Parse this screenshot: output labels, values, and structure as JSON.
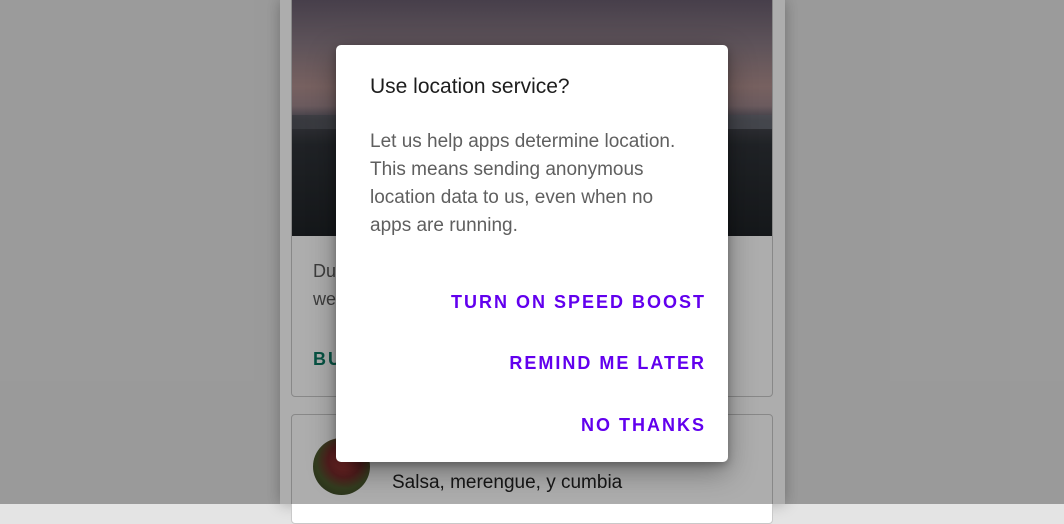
{
  "background_card": {
    "text_line_1": "Du",
    "text_line_2": "we",
    "action_label": "BU"
  },
  "second_card": {
    "subtitle": "Salsa, merengue, y cumbia"
  },
  "dialog": {
    "title": "Use location service?",
    "body": "Let us help apps determine location. This means sending anonymous location data to us, even when no apps are running.",
    "actions": [
      {
        "label": "TURN ON SPEED BOOST"
      },
      {
        "label": "REMIND ME LATER"
      },
      {
        "label": "NO THANKS"
      }
    ]
  },
  "colors": {
    "accent": "#6200ee",
    "secondary": "#0b7a63",
    "scrim": "rgba(0,0,0,0.32)"
  }
}
